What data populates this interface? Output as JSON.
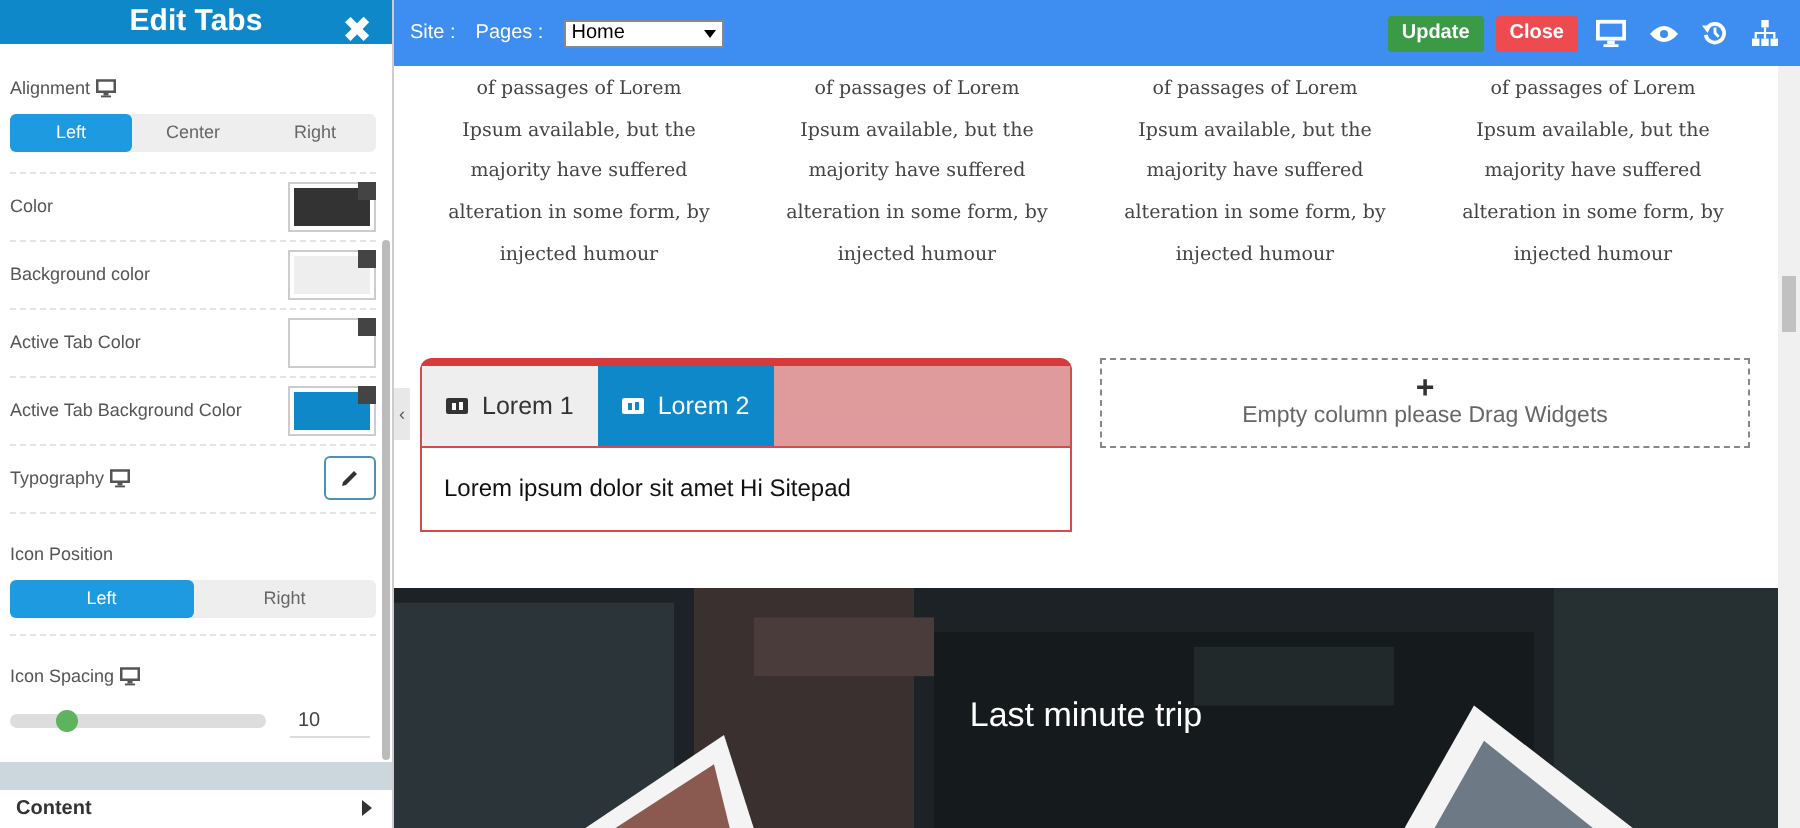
{
  "panel": {
    "title": "Edit Tabs",
    "close": "✖",
    "alignment": {
      "label": "Alignment",
      "options": [
        {
          "label": "Left",
          "selected": true
        },
        {
          "label": "Center",
          "selected": false
        },
        {
          "label": "Right",
          "selected": false
        }
      ]
    },
    "colors": [
      {
        "label": "Color",
        "color": "#333333"
      },
      {
        "label": "Background color",
        "color": "#eeeeee"
      },
      {
        "label": "Active Tab Color",
        "color": "#ffffff"
      },
      {
        "label": "Active Tab Background Color",
        "color": "#0e88c8"
      }
    ],
    "typography": {
      "label": "Typography"
    },
    "icon_position": {
      "label": "Icon Position",
      "options": [
        {
          "label": "Left",
          "selected": true
        },
        {
          "label": "Right",
          "selected": false
        }
      ]
    },
    "icon_spacing": {
      "label": "Icon Spacing",
      "level": 0.22,
      "value": "10"
    },
    "content_section": {
      "label": "Content",
      "expanded": false
    }
  },
  "toolbar": {
    "site_label": "Site :",
    "pages_label": "Pages :",
    "page": "Home",
    "update": "Update",
    "close": "Close"
  },
  "columns": [
    [
      "of passages of Lorem",
      "Ipsum available, but the",
      "majority have suffered",
      "alteration in some form, by",
      "injected humour"
    ],
    [
      "of passages of Lorem",
      "Ipsum available, but the",
      "majority have suffered",
      "alteration in some form, by",
      "injected humour"
    ],
    [
      "of passages of Lorem",
      "Ipsum available, but the",
      "majority have suffered",
      "alteration in some form, by",
      "injected humour"
    ],
    [
      "of passages of Lorem",
      "Ipsum available, but the",
      "majority have suffered",
      "alteration in some form, by",
      "injected humour"
    ]
  ],
  "tabs_widget": {
    "tabs": [
      {
        "label": "Lorem 1",
        "selected": false
      },
      {
        "label": "Lorem 2",
        "selected": true
      }
    ],
    "content": "Lorem ipsum dolor sit amet Hi Sitepad"
  },
  "empty_column": {
    "plus": "+",
    "text": "Empty column please Drag Widgets"
  },
  "collapse": "‹",
  "banner": {
    "kind": "picture",
    "title": "Last minute trip"
  }
}
